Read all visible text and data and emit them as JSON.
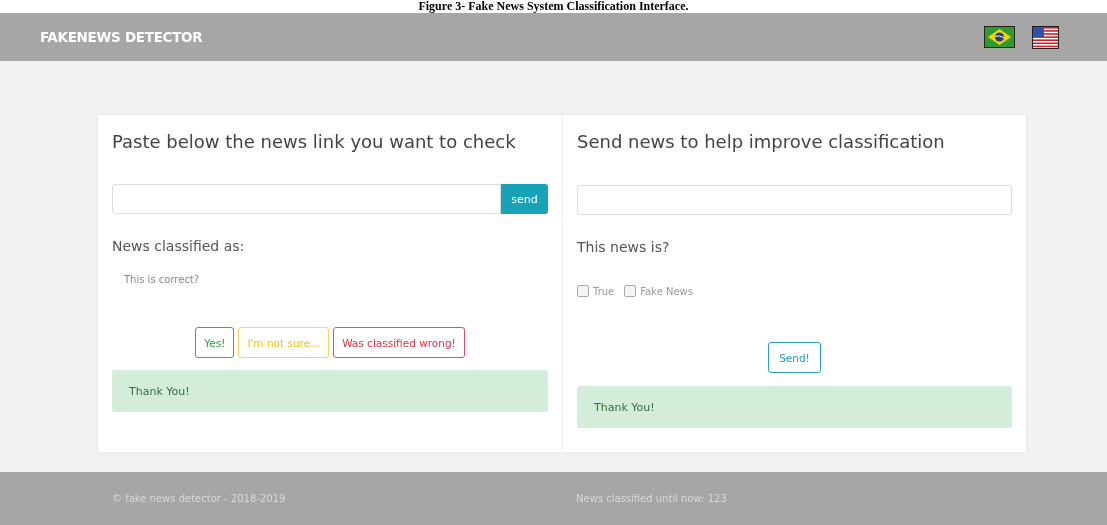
{
  "caption": "Figure 3- Fake News System Classification Interface.",
  "navbar": {
    "brand": "FAKENEWS DETECTOR",
    "languages": [
      {
        "kind": "brazil"
      },
      {
        "kind": "usa"
      }
    ]
  },
  "check_panel": {
    "title": "Paste below the news link you want to check",
    "send_button": "send",
    "result_label": "News classified as:",
    "question": "This is correct?",
    "feedback_buttons": [
      {
        "label": "Yes!",
        "kind": "success"
      },
      {
        "label": "I'm not sure...",
        "kind": "warning"
      },
      {
        "label": "Was classified wrong!",
        "kind": "danger"
      }
    ],
    "alert": "Thank You!"
  },
  "submit_panel": {
    "title": "Send news to help improve classification",
    "question": "This news is?",
    "options": [
      {
        "label": "True",
        "checked": false
      },
      {
        "label": "Fake News",
        "checked": false
      }
    ],
    "send_button": "Send!",
    "alert": "Thank You!"
  },
  "footer": {
    "copyright": "© fake news detector - 2018-2019",
    "counter": "News classified until now: 123"
  }
}
